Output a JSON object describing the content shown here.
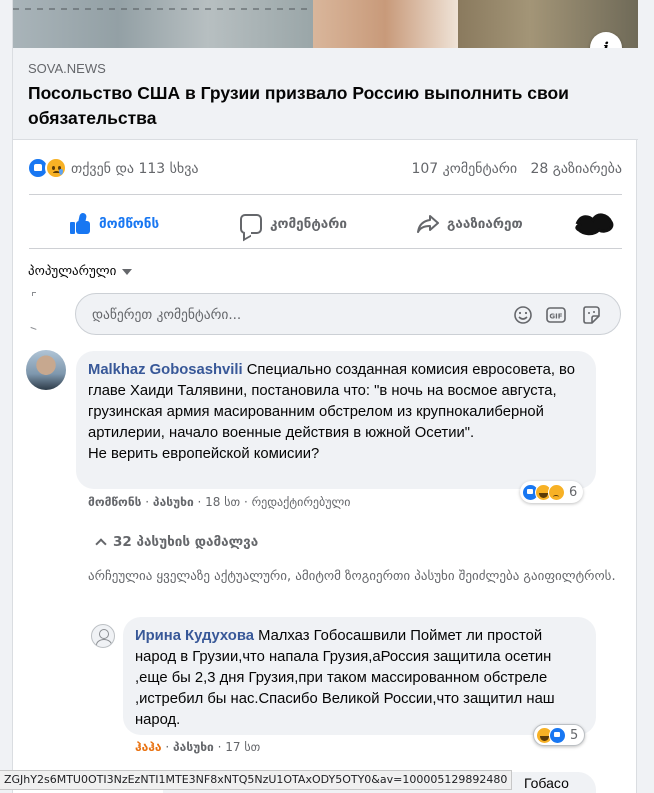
{
  "post": {
    "source": "SOVA.NEWS",
    "headline": "Посольство США в Грузии призвало Россию выполнить свои обязательства",
    "info_icon": "i"
  },
  "summary": {
    "reactions": [
      "like-icon",
      "sad-icon"
    ],
    "text": "თქვენ და 113 სხვა",
    "comments": "107 კომენტარი",
    "shares": "28 გაზიარება"
  },
  "actions": {
    "like": "მომწონს",
    "comment": "კომენტარი",
    "share": "გააზიარეთ"
  },
  "sort": {
    "label": "პოპულარული"
  },
  "comment_input": {
    "placeholder": "დაწერეთ კომენტარი..."
  },
  "comments": [
    {
      "author": "Malkhaz Gobosashvili",
      "text": "Специально созданная комисия евросовета, во главе Хаиди Талявини, постановила что: \"в ночь на восмое августа, грузинская армия масированним обстрелом из крупнокалиберной артилерии, начало военные действия в южной Осетии\".",
      "text2": "Не верить европейской комисии?",
      "like_action": "მომწონს",
      "reply_action": "პასუხი",
      "time": "18 სთ",
      "edited": "რედაქტირებული",
      "reaction_count": "6",
      "reactions": [
        "like-icon",
        "haha-icon",
        "sad-icon"
      ]
    },
    {
      "author": "Ирина Кудухова",
      "text": "Малхаз Гобосашвили Поймет ли простой народ в Грузии,что напала Грузия,аРоссия защитила осетин ,еще бы 2,3 дня Грузия,при таком массированном обстреле ,истребил бы нас.Спасибо Великой России,что защитил наш народ.",
      "like_action": "ჰაჰა",
      "reply_action": "პასუხი",
      "time": "17 სთ",
      "reaction_count": "5",
      "reactions": [
        "haha-icon",
        "like-icon"
      ]
    }
  ],
  "replies_toggle": "32 პასუხის დამალვა",
  "notice": "არჩეულია ყველაზე აქტუალური, ამიტომ ზოგიერთი პასუხი შეიძლება გაიფილტროს.",
  "partial_comment_text": "Гобасо",
  "status_url": "ZGJhY2s6MTU0OTI3NzEzNTI1MTE3NF8xNTQ5NzU1OTAxODY5OTY0&av=100005129892480"
}
